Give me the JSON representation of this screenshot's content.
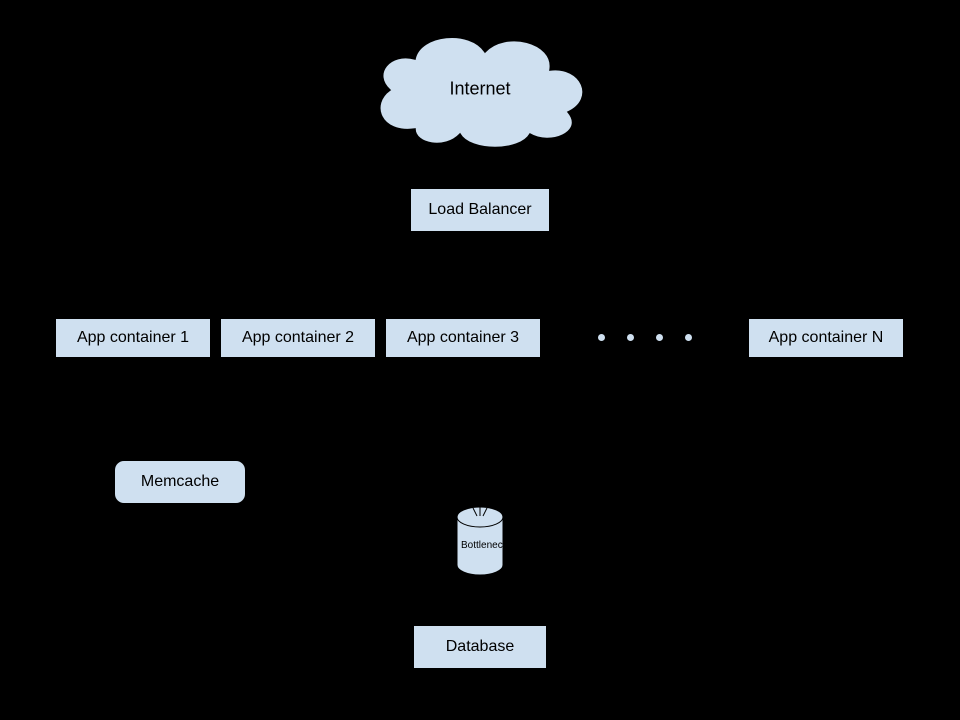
{
  "diagram": {
    "internet": "Internet",
    "load_balancer": "Load Balancer",
    "app_containers": {
      "c1": "App container 1",
      "c2": "App container 2",
      "c3": "App container 3",
      "cn": "App container N"
    },
    "memcache": "Memcache",
    "bottleneck": "Bottleneck",
    "database": "Database"
  }
}
